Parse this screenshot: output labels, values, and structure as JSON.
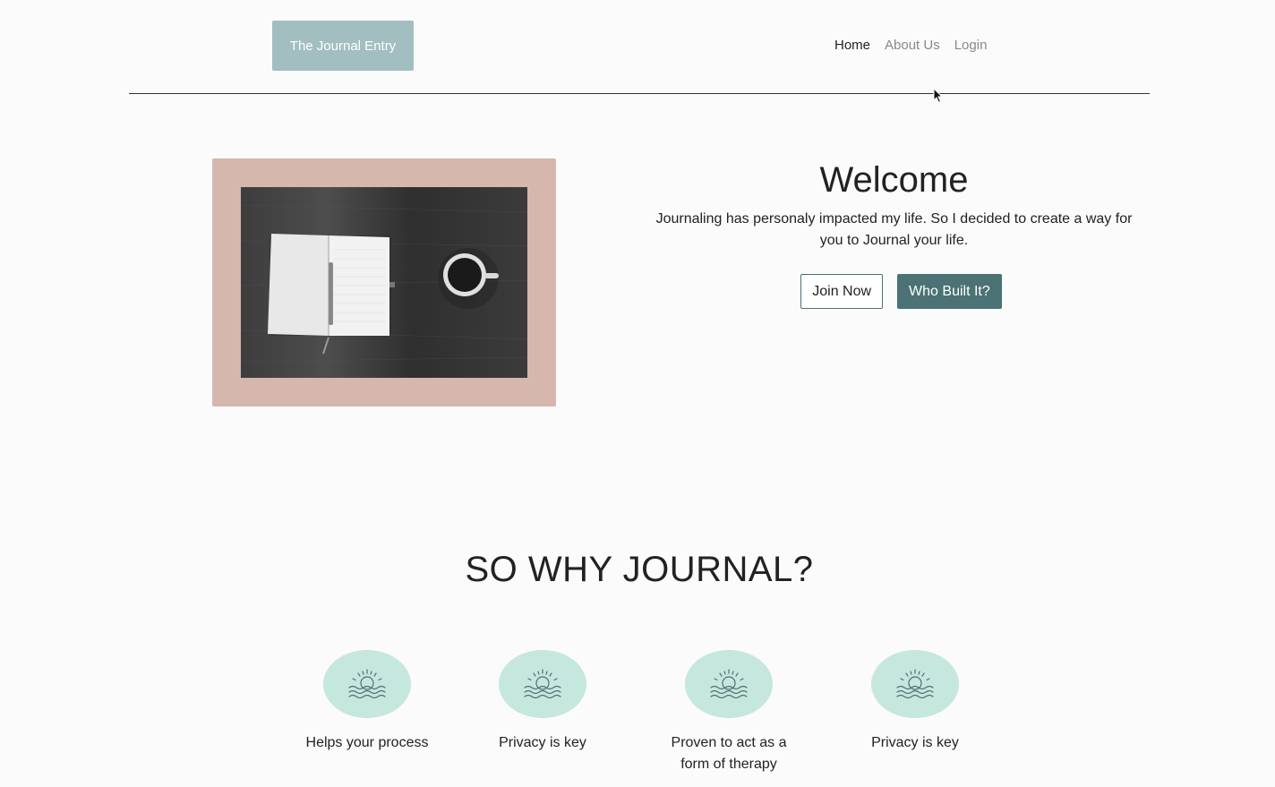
{
  "header": {
    "logo_text": "The Journal Entry",
    "nav": [
      {
        "label": "Home",
        "active": true
      },
      {
        "label": "About Us",
        "active": false
      },
      {
        "label": "Login",
        "active": false
      }
    ]
  },
  "hero": {
    "title": "Welcome",
    "description": "Journaling has personaly impacted my life. So I decided to create a way for you to Journal your life.",
    "join_button": "Join Now",
    "who_button": "Who Built It?"
  },
  "why": {
    "title": "SO WHY JOURNAL?",
    "features": [
      {
        "label": "Helps your process",
        "icon": "sunrise-icon"
      },
      {
        "label": "Privacy is key",
        "icon": "sunrise-icon"
      },
      {
        "label": "Proven to act as a form of therapy",
        "icon": "sunrise-icon"
      },
      {
        "label": "Privacy is key",
        "icon": "sunrise-icon"
      }
    ]
  },
  "colors": {
    "logo_bg": "#a3bec0",
    "hero_frame": "#d5b7ae",
    "accent": "#4b7274",
    "icon_bg": "#c6e7de"
  }
}
